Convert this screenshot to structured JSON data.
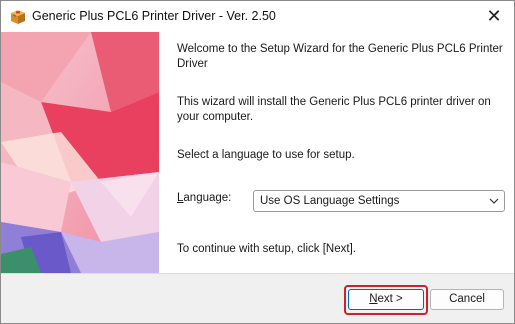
{
  "window": {
    "title": "Generic Plus PCL6 Printer Driver - Ver. 2.50",
    "close_glyph": "✕"
  },
  "content": {
    "welcome": "Welcome to the Setup Wizard for the Generic Plus PCL6 Printer Driver",
    "install_info": "This wizard will install the Generic Plus PCL6 printer driver on your computer.",
    "select_prompt": "Select a language to use for setup.",
    "language_label_prefix": "L",
    "language_label_rest": "anguage:",
    "language_value": "Use OS Language Settings",
    "continue_text": "To continue with setup, click [Next]."
  },
  "buttons": {
    "next_prefix": "N",
    "next_rest": "ext >",
    "cancel": "Cancel"
  },
  "colors": {
    "highlight": "#d0202a",
    "focus_border": "#0067c0"
  },
  "icons": {
    "app": "installer-box-icon",
    "close": "close-icon",
    "dropdown": "chevron-down-icon"
  }
}
